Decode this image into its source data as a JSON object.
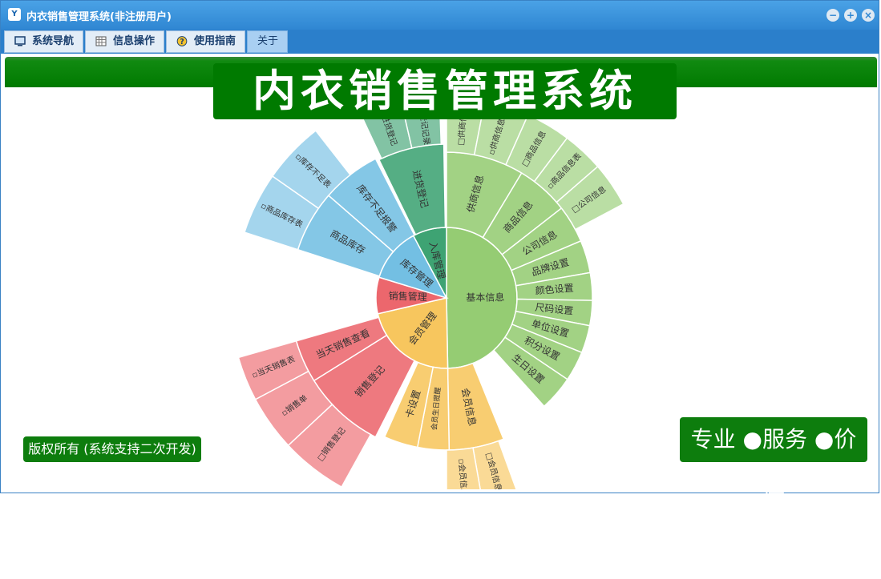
{
  "window": {
    "title": "内衣销售管理系统(非注册用户)",
    "controls": [
      "minimize-icon",
      "maximize-icon",
      "close-icon"
    ]
  },
  "tabs": [
    {
      "label": "系统导航",
      "icon": "monitor-icon"
    },
    {
      "label": "信息操作",
      "icon": "grid-icon"
    },
    {
      "label": "使用指南",
      "icon": "help-icon"
    },
    {
      "label": "关于",
      "icon": ""
    }
  ],
  "content": {
    "title": "内衣销售管理系统",
    "copyright": "版权所有 (系统支持二次开发)",
    "slogan": "专业 ●服务 ●价值"
  },
  "colors": {
    "green_banner": "#007a00",
    "titlebar": "#2f86d2",
    "basic_info": "#8cc86a",
    "member": "#f7c35c",
    "sales": "#e8636a",
    "stock": "#6fbce0",
    "purchase": "#3fa874"
  },
  "sunburst": {
    "inner": [
      {
        "name": "基本信息",
        "color": "#95cc73"
      },
      {
        "name": "会员管理",
        "color": "#f7c65e"
      },
      {
        "name": "销售管理",
        "color": "#ec676d"
      },
      {
        "name": "库存管理",
        "color": "#73bfe3"
      },
      {
        "name": "入库管理",
        "color": "#3ea373"
      }
    ],
    "middle": [
      {
        "name": "供商信息"
      },
      {
        "name": "商品信息"
      },
      {
        "name": "公司信息"
      },
      {
        "name": "品牌设置"
      },
      {
        "name": "颜色设置"
      },
      {
        "name": "尺码设置"
      },
      {
        "name": "单位设置"
      },
      {
        "name": "积分设置"
      },
      {
        "name": "生日设置"
      },
      {
        "name": "会员信息"
      },
      {
        "name": "会员生日提醒"
      },
      {
        "name": "卡设置"
      },
      {
        "name": "销售登记"
      },
      {
        "name": "当天销售查看"
      },
      {
        "name": "商品库存"
      },
      {
        "name": "库存不足报警"
      },
      {
        "name": "进货登记"
      }
    ],
    "outer": [
      {
        "name": "□供商信息"
      },
      {
        "name": "▫供商信息表"
      },
      {
        "name": "□商品信息"
      },
      {
        "name": "▫商品信息表"
      },
      {
        "name": "□公司信息"
      },
      {
        "name": "□会员信息"
      },
      {
        "name": "▫会员信息"
      },
      {
        "name": "□销售登记"
      },
      {
        "name": "▫销售单"
      },
      {
        "name": "▫当天销售表"
      },
      {
        "name": "▫商品库存表"
      },
      {
        "name": "▫库存不足表"
      },
      {
        "name": "□进货登记"
      },
      {
        "name": "▫进货登记记录"
      }
    ]
  }
}
